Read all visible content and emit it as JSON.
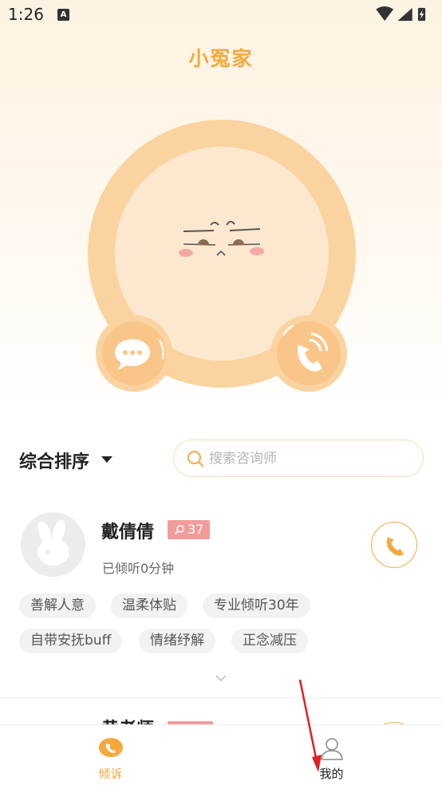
{
  "status_bar": {
    "time": "1:26",
    "notification_icon_letter": "A"
  },
  "app": {
    "title": "小冤家"
  },
  "filter": {
    "sort_label": "综合排序",
    "search_placeholder": "搜索咨询师"
  },
  "counselors": [
    {
      "name": "戴倩倩",
      "badge_count": "37",
      "listened_text": "已倾听0分钟",
      "tags": [
        "善解人意",
        "温柔体贴",
        "专业倾听30年",
        "自带安抚buff",
        "情绪纾解",
        "正念减压"
      ]
    },
    {
      "name": "黄老师"
    }
  ],
  "tabbar": {
    "items": [
      {
        "label": "倾诉",
        "icon": "phone-icon",
        "active": true
      },
      {
        "label": "我的",
        "icon": "person-icon",
        "active": false
      }
    ]
  },
  "colors": {
    "accent": "#f5a93d",
    "badge": "#f29b9b",
    "annotation_arrow": "#e02020"
  }
}
